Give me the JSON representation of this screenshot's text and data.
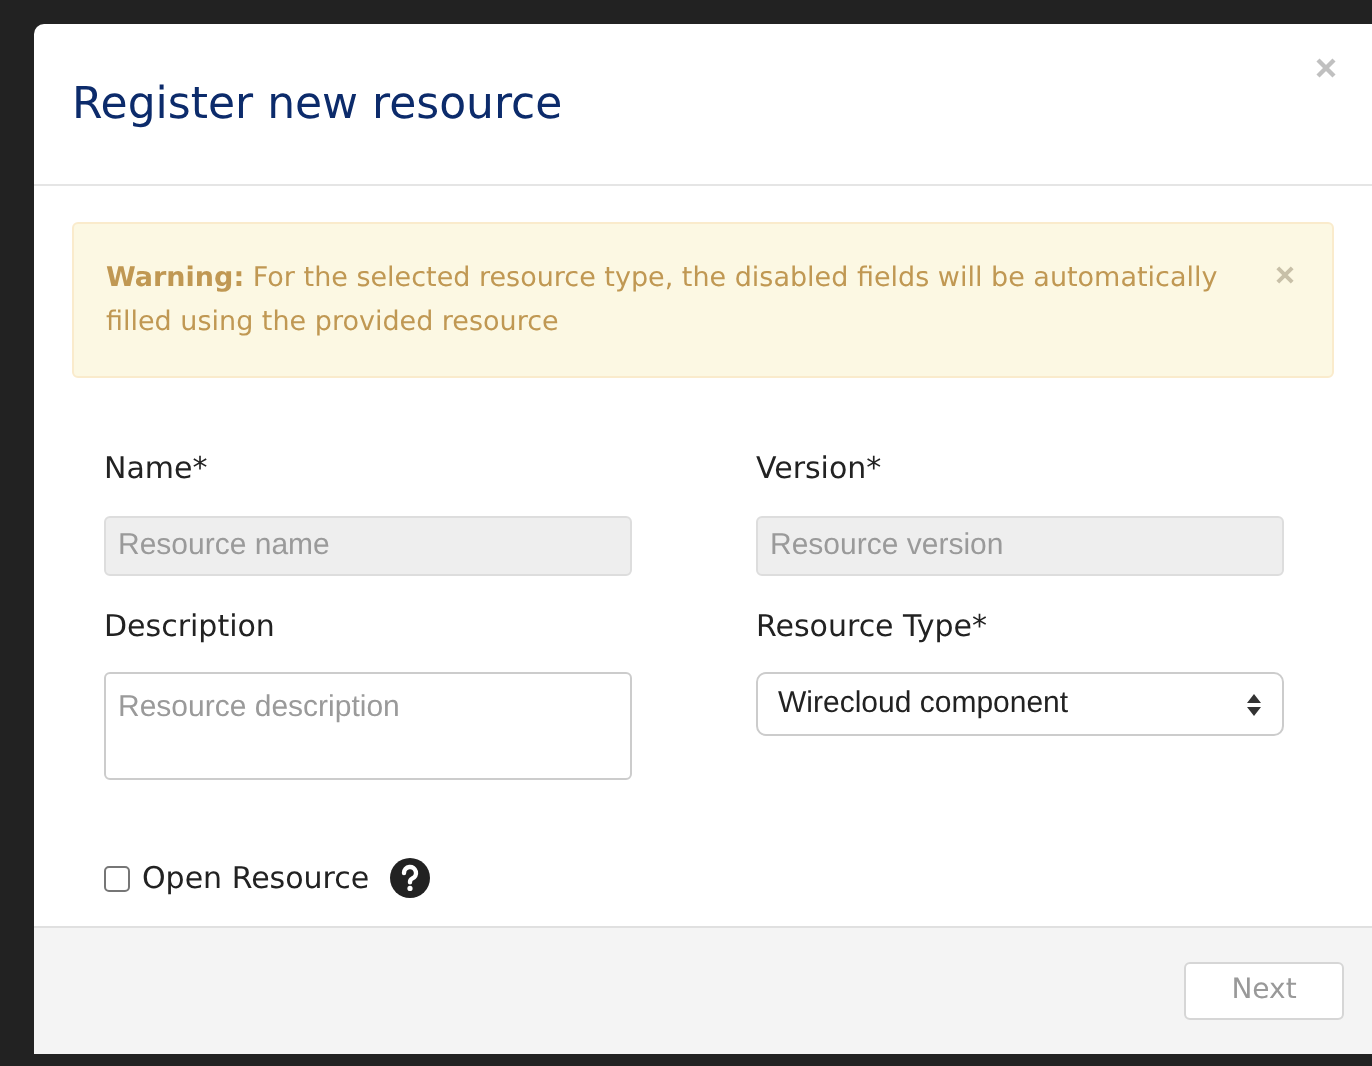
{
  "dialog": {
    "title": "Register new resource",
    "alert": {
      "text": "**Warning:** For the selected resource type, the disabled fields will be automatically filled using the provided resource"
    },
    "fields": [
      {
        "kind": "input",
        "label": "Name*",
        "placeholder": "Resource name",
        "disabled": true
      },
      {
        "kind": "input",
        "label": "Version*",
        "placeholder": "Resource version",
        "disabled": true
      },
      {
        "kind": "textarea",
        "label": "Description",
        "placeholder": "Resource description",
        "disabled": false
      },
      {
        "kind": "select",
        "label": "Resource Type*",
        "value": "Wirecloud component",
        "disabled": false
      }
    ],
    "checkbox": {
      "label": "Open Resource",
      "checked": false
    },
    "buttons": [
      {
        "label": "Next",
        "disabled": true
      }
    ]
  }
}
